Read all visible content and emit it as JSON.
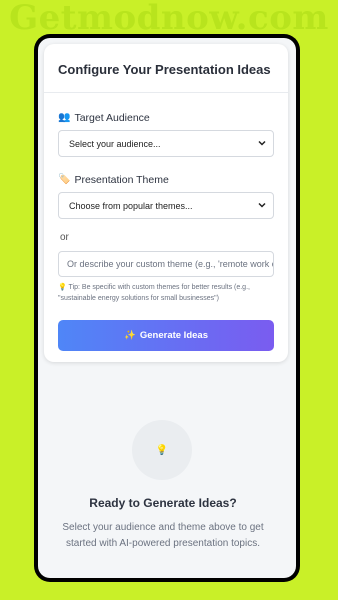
{
  "watermark": "Getmodnow.com",
  "form": {
    "title": "Configure Your Presentation Ideas",
    "audience_label": "Target Audience",
    "audience_icon": "people-icon",
    "audience_selected": "Select your audience...",
    "theme_label": "Presentation Theme",
    "theme_icon": "tag-icon",
    "theme_selected": "Choose from popular themes...",
    "or_text": "or",
    "custom_placeholder": "Or describe your custom theme (e.g., 'remote work c",
    "tip_icon": "lightbulb-icon",
    "tip_text": "Tip: Be specific with custom themes for better results (e.g., \"sustainable energy solutions for small businesses\")",
    "generate_label": "Generate Ideas",
    "generate_icon": "sparkles-icon"
  },
  "empty_state": {
    "icon": "lightbulb-icon",
    "title": "Ready to Generate Ideas?",
    "subtitle": "Select your audience and theme above to get started with AI-powered presentation topics."
  },
  "colors": {
    "background": "#c9f028",
    "button_start": "#4f86f7",
    "button_end": "#7a5cf0"
  }
}
